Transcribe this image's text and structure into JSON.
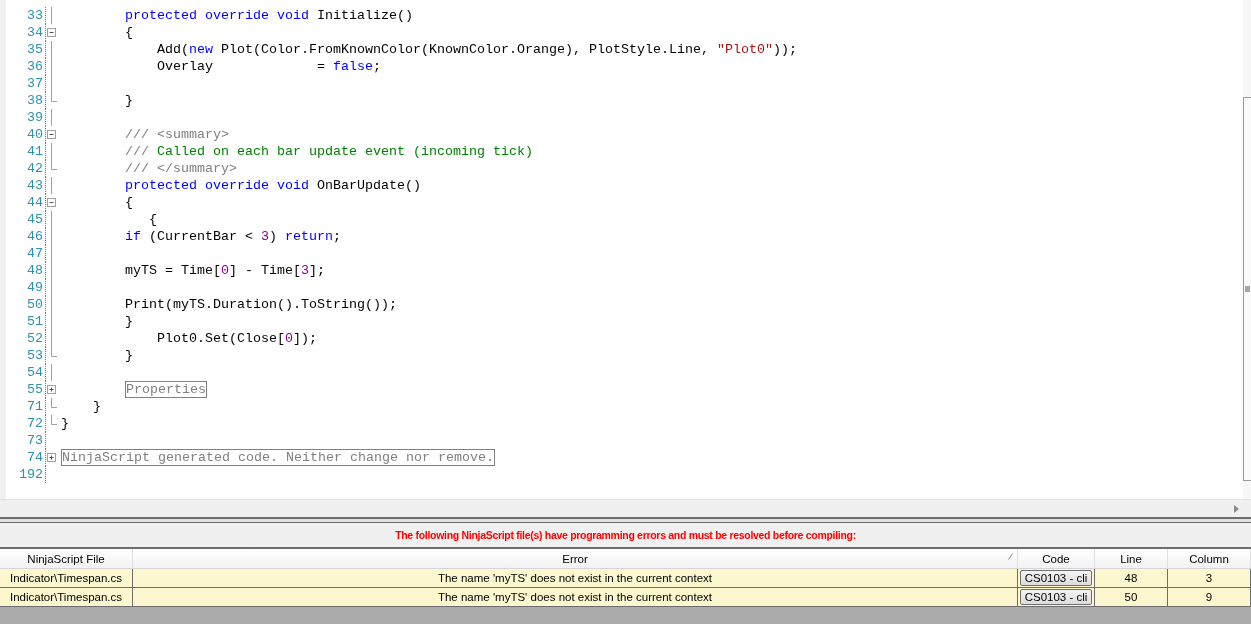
{
  "editor": {
    "lines": [
      {
        "number": "33",
        "kind": "line",
        "segments": [
          {
            "kind": "kw",
            "t": "        protected override void"
          },
          {
            "kind": "p",
            "t": " Initialize()"
          }
        ]
      },
      {
        "number": "34",
        "kind": "minus",
        "segments": [
          {
            "kind": "p",
            "t": "        {"
          }
        ]
      },
      {
        "number": "35",
        "kind": "line",
        "segments": [
          {
            "kind": "p",
            "t": "            Add("
          },
          {
            "kind": "kw",
            "t": "new"
          },
          {
            "kind": "p",
            "t": " Plot(Color.FromKnownColor(KnownColor.Orange), PlotStyle.Line, "
          },
          {
            "kind": "s",
            "t": "\"Plot0\""
          },
          {
            "kind": "p",
            "t": "));"
          }
        ]
      },
      {
        "number": "36",
        "kind": "line",
        "segments": [
          {
            "kind": "p",
            "t": "            Overlay             = "
          },
          {
            "kind": "kw",
            "t": "false"
          },
          {
            "kind": "p",
            "t": ";"
          }
        ]
      },
      {
        "number": "37",
        "kind": "line"
      },
      {
        "number": "38",
        "kind": "end",
        "segments": [
          {
            "kind": "p",
            "t": "        }"
          }
        ]
      },
      {
        "number": "39",
        "kind": "line"
      },
      {
        "number": "40",
        "kind": "minus",
        "segments": [
          {
            "kind": "d",
            "t": "        /// <summary>"
          }
        ]
      },
      {
        "number": "41",
        "kind": "line",
        "segments": [
          {
            "kind": "d",
            "t": "        /// "
          },
          {
            "kind": "c",
            "t": "Called on each bar update event (incoming tick)"
          }
        ]
      },
      {
        "number": "42",
        "kind": "end",
        "segments": [
          {
            "kind": "d",
            "t": "        /// </summary>"
          }
        ]
      },
      {
        "number": "43",
        "kind": "line",
        "segments": [
          {
            "kind": "kw",
            "t": "        protected override void"
          },
          {
            "kind": "p",
            "t": " OnBarUpdate()"
          }
        ]
      },
      {
        "number": "44",
        "kind": "minus",
        "segments": [
          {
            "kind": "p",
            "t": "        {"
          }
        ]
      },
      {
        "number": "45",
        "kind": "line",
        "segments": [
          {
            "kind": "p",
            "t": "           {"
          }
        ]
      },
      {
        "number": "46",
        "kind": "line",
        "segments": [
          {
            "kind": "kw",
            "t": "        if"
          },
          {
            "kind": "p",
            "t": " (CurrentBar < "
          },
          {
            "kind": "n",
            "t": "3"
          },
          {
            "kind": "p",
            "t": ") "
          },
          {
            "kind": "kw",
            "t": "return"
          },
          {
            "kind": "p",
            "t": ";"
          }
        ]
      },
      {
        "number": "47",
        "kind": "line"
      },
      {
        "number": "48",
        "kind": "line",
        "segments": [
          {
            "kind": "p",
            "t": "        myTS = Time["
          },
          {
            "kind": "n",
            "t": "0"
          },
          {
            "kind": "p",
            "t": "] - Time["
          },
          {
            "kind": "n",
            "t": "3"
          },
          {
            "kind": "p",
            "t": "];"
          }
        ]
      },
      {
        "number": "49",
        "kind": "line"
      },
      {
        "number": "50",
        "kind": "line",
        "segments": [
          {
            "kind": "p",
            "t": "        Print(myTS.Duration().ToString());"
          }
        ]
      },
      {
        "number": "51",
        "kind": "line",
        "segments": [
          {
            "kind": "p",
            "t": "        }"
          }
        ]
      },
      {
        "number": "52",
        "kind": "line",
        "segments": [
          {
            "kind": "p",
            "t": "            Plot0.Set(Close["
          },
          {
            "kind": "n",
            "t": "0"
          },
          {
            "kind": "p",
            "t": "]);"
          }
        ]
      },
      {
        "number": "53",
        "kind": "end",
        "segments": [
          {
            "kind": "p",
            "t": "        }"
          }
        ]
      },
      {
        "number": "54",
        "kind": "line"
      },
      {
        "number": "55",
        "kind": "plus",
        "segments": [
          {
            "kind": "r",
            "t": "        Properties"
          }
        ]
      },
      {
        "number": "71",
        "kind": "end",
        "segments": [
          {
            "kind": "p",
            "t": "    }"
          }
        ]
      },
      {
        "number": "72",
        "kind": "end",
        "segments": [
          {
            "kind": "p",
            "t": "}"
          }
        ]
      },
      {
        "number": "73",
        "kind": "none"
      },
      {
        "number": "74",
        "kind": "plus",
        "segments": [
          {
            "kind": "r",
            "t": "NinjaScript generated code. Neither change nor remove."
          }
        ]
      },
      {
        "number": "192",
        "kind": "none"
      }
    ]
  },
  "error_panel": {
    "message": "The following NinjaScript file(s) have programming errors and must be resolved before compiling:",
    "columns": [
      {
        "label": "NinjaScript File",
        "sorted": false
      },
      {
        "label": "Error",
        "sorted": true
      },
      {
        "label": "Code",
        "sorted": false
      },
      {
        "label": "Line",
        "sorted": false
      },
      {
        "label": "Column",
        "sorted": false
      }
    ],
    "rows": [
      {
        "file": "Indicator\\Timespan.cs",
        "error": "The name 'myTS' does not exist in the current context",
        "code": "CS0103 - cli",
        "line": "48",
        "column": "3"
      },
      {
        "file": "Indicator\\Timespan.cs",
        "error": "The name 'myTS' does not exist in the current context",
        "code": "CS0103 - cli",
        "line": "50",
        "column": "9"
      }
    ]
  }
}
